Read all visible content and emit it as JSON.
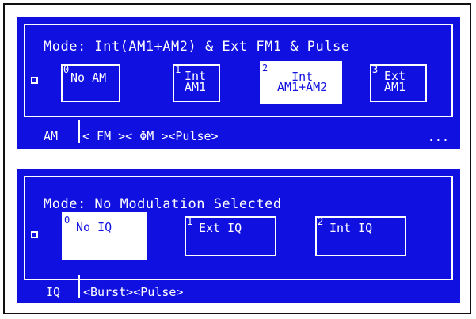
{
  "am_panel": {
    "mode": "Mode: Int(AM1+AM2) & Ext FM1 & Pulse",
    "softkeys": [
      {
        "num": "0",
        "label": "No AM",
        "selected": false
      },
      {
        "num": "1",
        "label": "Int\nAM1",
        "selected": false
      },
      {
        "num": "2",
        "label": "Int\nAM1+AM2",
        "selected": true
      },
      {
        "num": "3",
        "label": "Ext\nAM1",
        "selected": false
      }
    ],
    "current_tab": "AM",
    "tabs": "< FM >< ΦM ><Pulse>",
    "more": "..."
  },
  "iq_panel": {
    "mode": "Mode: No Modulation Selected",
    "softkeys": [
      {
        "num": "0",
        "label": "No IQ",
        "selected": true
      },
      {
        "num": "1",
        "label": "Ext IQ",
        "selected": false
      },
      {
        "num": "2",
        "label": "Int IQ",
        "selected": false
      }
    ],
    "current_tab": "IQ",
    "tabs": "<Burst><Pulse>"
  },
  "colors": {
    "screen_bg": "#1010e0",
    "fg": "#ffffff"
  }
}
